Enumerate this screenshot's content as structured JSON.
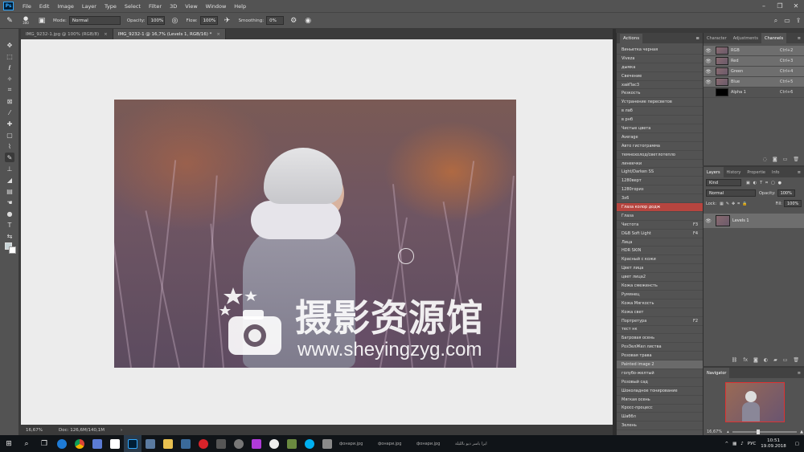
{
  "menu": [
    "File",
    "Edit",
    "Image",
    "Layer",
    "Type",
    "Select",
    "Filter",
    "3D",
    "View",
    "Window",
    "Help"
  ],
  "ps_logo": "Ps",
  "options": {
    "brush_size": "300",
    "mode_label": "Mode:",
    "mode_value": "Normal",
    "opacity_label": "Opacity:",
    "opacity_value": "100%",
    "flow_label": "Flow:",
    "flow_value": "100%",
    "smoothing_label": "Smoothing:",
    "smoothing_value": "0%"
  },
  "tabs": [
    {
      "label": "IMG_9232-1.jpg @ 100% (RGB/8)"
    },
    {
      "label": "IMG_9232-1 @ 16,7% (Levels 1, RGB/16) *"
    }
  ],
  "watermark": {
    "title": "摄影资源馆",
    "url": "www.sheyingzyg.com"
  },
  "status": {
    "zoom": "16,67%",
    "doc": "Doc: 126,6M/140,1M"
  },
  "actions_panel": {
    "title": "Actions",
    "items": [
      {
        "label": "Виньетка черная",
        "key": ""
      },
      {
        "label": "Viveza",
        "key": ""
      },
      {
        "label": "дымка",
        "key": ""
      },
      {
        "label": "Свечение",
        "key": ""
      },
      {
        "label": "хайПас3",
        "key": ""
      },
      {
        "label": "Резкость",
        "key": ""
      },
      {
        "label": "Устранение пересветов",
        "key": ""
      },
      {
        "label": "в лаб",
        "key": ""
      },
      {
        "label": "в рнб",
        "key": ""
      },
      {
        "label": "Чистые цвета",
        "key": ""
      },
      {
        "label": "Average",
        "key": ""
      },
      {
        "label": "Авто гистограмма",
        "key": ""
      },
      {
        "label": "темнохолод/светлотепло",
        "key": ""
      },
      {
        "label": "линеечки",
        "key": ""
      },
      {
        "label": "Light/Darken SS",
        "key": ""
      },
      {
        "label": "1280верт",
        "key": ""
      },
      {
        "label": "1280гориз",
        "key": ""
      },
      {
        "label": "3x6",
        "key": ""
      },
      {
        "label": "Глаза колор додж",
        "key": ""
      },
      {
        "label": "Глаза",
        "key": ""
      },
      {
        "label": "Чистота",
        "key": "F3"
      },
      {
        "label": "D&B Soft Light",
        "key": "F4"
      },
      {
        "label": "Лица",
        "key": ""
      },
      {
        "label": "HDR SKIN",
        "key": ""
      },
      {
        "label": "Красный с кожи",
        "key": ""
      },
      {
        "label": "Цвет лица",
        "key": ""
      },
      {
        "label": "цвет лица2",
        "key": ""
      },
      {
        "label": "Кожа смеженсть",
        "key": ""
      },
      {
        "label": "Румянец",
        "key": ""
      },
      {
        "label": "Кожа Мягкость",
        "key": ""
      },
      {
        "label": "Кожа свет",
        "key": ""
      },
      {
        "label": "Портретура",
        "key": "F2"
      },
      {
        "label": "тест нк",
        "key": ""
      },
      {
        "label": "Багровая осень",
        "key": ""
      },
      {
        "label": "РозЗелЖел листва",
        "key": ""
      },
      {
        "label": "Розовая трава",
        "key": ""
      },
      {
        "label": "Painted image 2",
        "key": ""
      },
      {
        "label": "голубо-желтый",
        "key": ""
      },
      {
        "label": "Розовый сад",
        "key": ""
      },
      {
        "label": "Шоколадное тонирование",
        "key": ""
      },
      {
        "label": "Мягкая осень",
        "key": ""
      },
      {
        "label": "Кросс-процесс",
        "key": ""
      },
      {
        "label": "Шаббл",
        "key": ""
      },
      {
        "label": "Зелень",
        "key": ""
      }
    ]
  },
  "channels_panel": {
    "tabs": [
      "Character",
      "Adjustments",
      "Channels"
    ],
    "rows": [
      {
        "name": "RGB",
        "key": "Ctrl+2"
      },
      {
        "name": "Red",
        "key": "Ctrl+3"
      },
      {
        "name": "Green",
        "key": "Ctrl+4"
      },
      {
        "name": "Blue",
        "key": "Ctrl+5"
      },
      {
        "name": "Alpha 1",
        "key": "Ctrl+6"
      }
    ]
  },
  "layers_panel": {
    "tabs": [
      "Layers",
      "History",
      "Propertie",
      "Info"
    ],
    "kind": "Kind",
    "blend": "Normal",
    "opacity_label": "Opacity:",
    "opacity": "100%",
    "lock_label": "Lock:",
    "fill_label": "Fill:",
    "fill": "100%",
    "layer_name": "Levels 1"
  },
  "navigator": {
    "title": "Navigator",
    "zoom": "16,67%"
  },
  "taskbar": {
    "files": [
      "фонари.jpg",
      "фонари.jpg",
      "фонари.jpg",
      "ايزا ياسر ديو بالليلة"
    ],
    "lang": "РУС",
    "time": "10:51",
    "date": "19.09.2018"
  }
}
